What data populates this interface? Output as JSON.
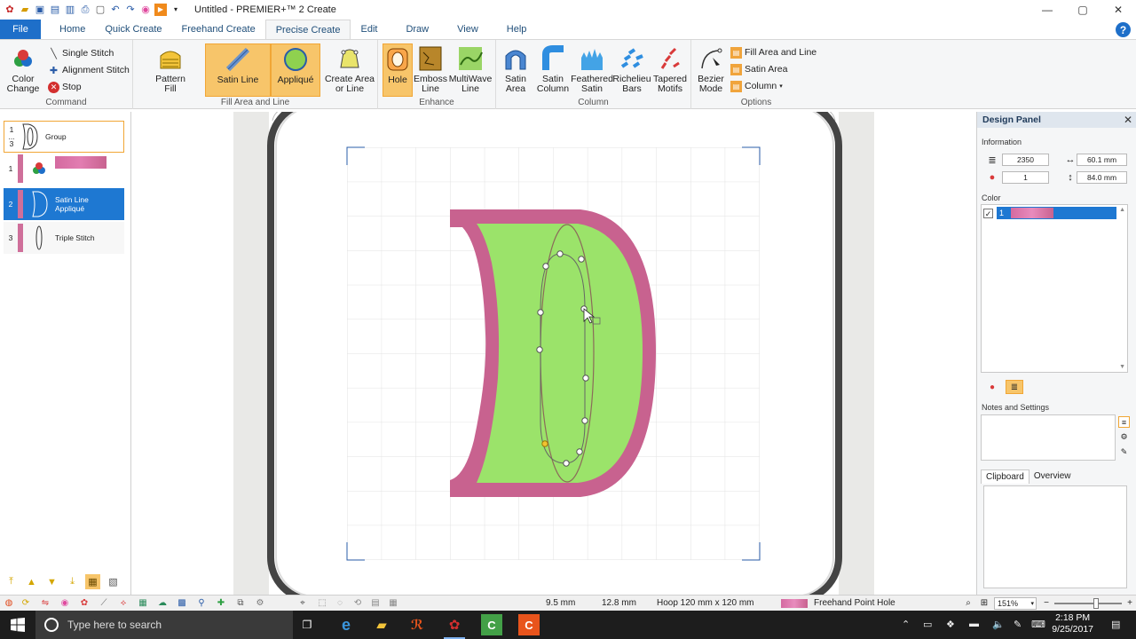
{
  "window": {
    "title": "Untitled - PREMIER+™ 2 Create",
    "minimize": "—",
    "maximize": "▢",
    "close": "✕"
  },
  "menu": {
    "file": "File",
    "tabs": [
      "Home",
      "Quick Create",
      "Freehand Create",
      "Precise Create",
      "Edit",
      "Draw",
      "View",
      "Help"
    ],
    "active_tab": "Precise Create",
    "help": "?"
  },
  "ribbon": {
    "command": {
      "label": "Command",
      "color_change": "Color Change",
      "single_stitch": "Single Stitch",
      "alignment_stitch": "Alignment Stitch",
      "stop": "Stop"
    },
    "fill_area": {
      "label": "Fill Area and Line",
      "pattern_fill": "Pattern Fill",
      "satin_line": "Satin Line",
      "applique": "Appliqué",
      "create_area": "Create Area or Line"
    },
    "enhance": {
      "label": "Enhance",
      "hole": "Hole",
      "emboss_line": "Emboss Line",
      "multiwave_line": "MultiWave Line"
    },
    "column": {
      "label": "Column",
      "satin_area": "Satin Area",
      "satin_column": "Satin Column",
      "feathered_satin": "Feathered Satin",
      "richelieu_bars": "Richelieu Bars",
      "tapered_motifs": "Tapered Motifs"
    },
    "options": {
      "label": "Options",
      "bezier_mode": "Bezier Mode",
      "fill_area_and_line": "Fill Area and Line",
      "satin_area": "Satin Area",
      "column": "Column"
    }
  },
  "sequence": [
    {
      "num": "1\n...\n3",
      "label": "Group",
      "selected": false
    },
    {
      "num": "1",
      "label": "",
      "selected": false
    },
    {
      "num": "2",
      "label": "Satin Line\nAppliqué",
      "selected": true
    },
    {
      "num": "3",
      "label": "Triple Stitch",
      "selected": false
    }
  ],
  "design_panel": {
    "title": "Design Panel",
    "information_label": "Information",
    "stitches": "2350",
    "colors": "1",
    "width": "60.1 mm",
    "height": "84.0 mm",
    "color_label": "Color",
    "color_item": "1",
    "notes_label": "Notes and Settings",
    "clipboard_tab": "Clipboard",
    "overview_tab": "Overview"
  },
  "status": {
    "x": "9.5 mm",
    "y": "12.8 mm",
    "hoop": "Hoop 120 mm x 120 mm",
    "mode": "Freehand Point Hole",
    "zoom": "151%"
  },
  "taskbar": {
    "search_placeholder": "Type here to search",
    "time": "2:18 PM",
    "date": "9/25/2017"
  },
  "colors": {
    "accent": "#1e6fc9",
    "satin_border": "#c8628f",
    "fill": "#9be36a",
    "ribbon_highlight": "#f7c56a"
  }
}
